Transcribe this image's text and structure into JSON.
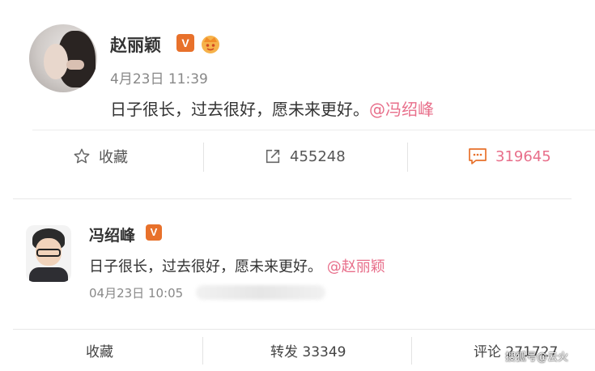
{
  "post1": {
    "user_name": "赵丽颖",
    "verified_badge": "V",
    "time": "4月23日 11:39",
    "text": "日子很长，过去很好，愿未来更好。",
    "mention": "@冯绍峰",
    "actions": {
      "favorite_label": "收藏",
      "forward_count": "455248",
      "comment_count": "319645"
    }
  },
  "post2": {
    "user_name": "冯绍峰",
    "verified_badge": "V",
    "text": "日子很长，过去很好，愿未来更好。",
    "mention": "@赵丽颖",
    "time": "04月23日 10:05",
    "actions": {
      "favorite_label": "收藏",
      "forward_label": "转发 33349",
      "comment_label": "评论 271727"
    }
  },
  "watermark": "搜狐号@云火",
  "colors": {
    "mention": "#e86e8a",
    "badge": "#e8712b"
  }
}
